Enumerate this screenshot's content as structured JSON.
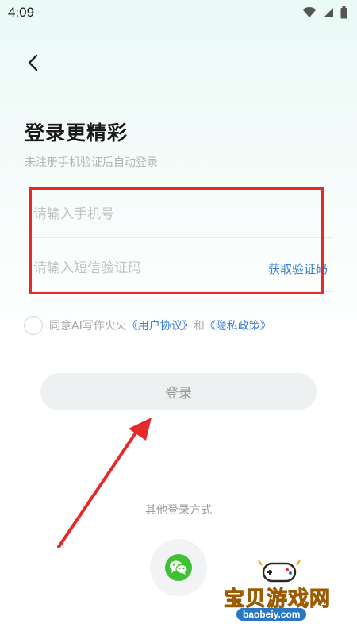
{
  "status_bar": {
    "time": "4:09",
    "icons": [
      "wifi-icon",
      "cellular-signal-icon",
      "battery-icon"
    ]
  },
  "header": {
    "back_icon": "chevron-left-icon"
  },
  "login": {
    "title": "登录更精彩",
    "subtitle": "未注册手机验证后自动登录",
    "phone_placeholder": "请输入手机号",
    "code_placeholder": "请输入短信验证码",
    "get_code_label": "获取验证码",
    "agreement": {
      "prefix": "同意AI写作火火",
      "user_agreement": "《用户协议》",
      "and": "和",
      "privacy_policy": "《隐私政策》"
    },
    "login_button": "登录"
  },
  "other_login": {
    "label": "其他登录方式",
    "wechat_icon": "wechat-icon"
  },
  "watermark": {
    "text": "宝贝游戏网",
    "url": "baobeiy.com"
  },
  "colors": {
    "accent_link": "#3a7fd6",
    "highlight_box": "#e42a2a",
    "annotation_arrow": "#e42a2a",
    "wechat_green": "#3ec133",
    "login_button_bg": "#eef1f2"
  }
}
